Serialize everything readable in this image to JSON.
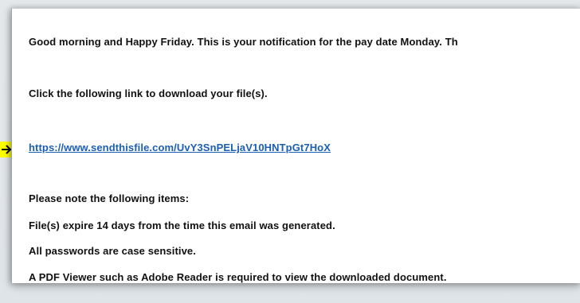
{
  "email": {
    "greeting": "Good morning and Happy Friday.  This is your notification for the pay date Monday.  Th",
    "instruction": "Click the following link to download your file(s).",
    "link": "https://www.sendthisfile.com/UvY3SnPELjaV10HNTpGt7HoX",
    "notes_heading": "Please note the following items:",
    "note_expire": "File(s) expire 14 days from the time this email was generated.",
    "note_passwords": "All passwords are case sensitive.",
    "note_pdf": "A PDF Viewer such as Adobe Reader is required to view the downloaded document."
  },
  "marker": {
    "icon": "arrow-right-icon",
    "color": "#ffff00"
  }
}
